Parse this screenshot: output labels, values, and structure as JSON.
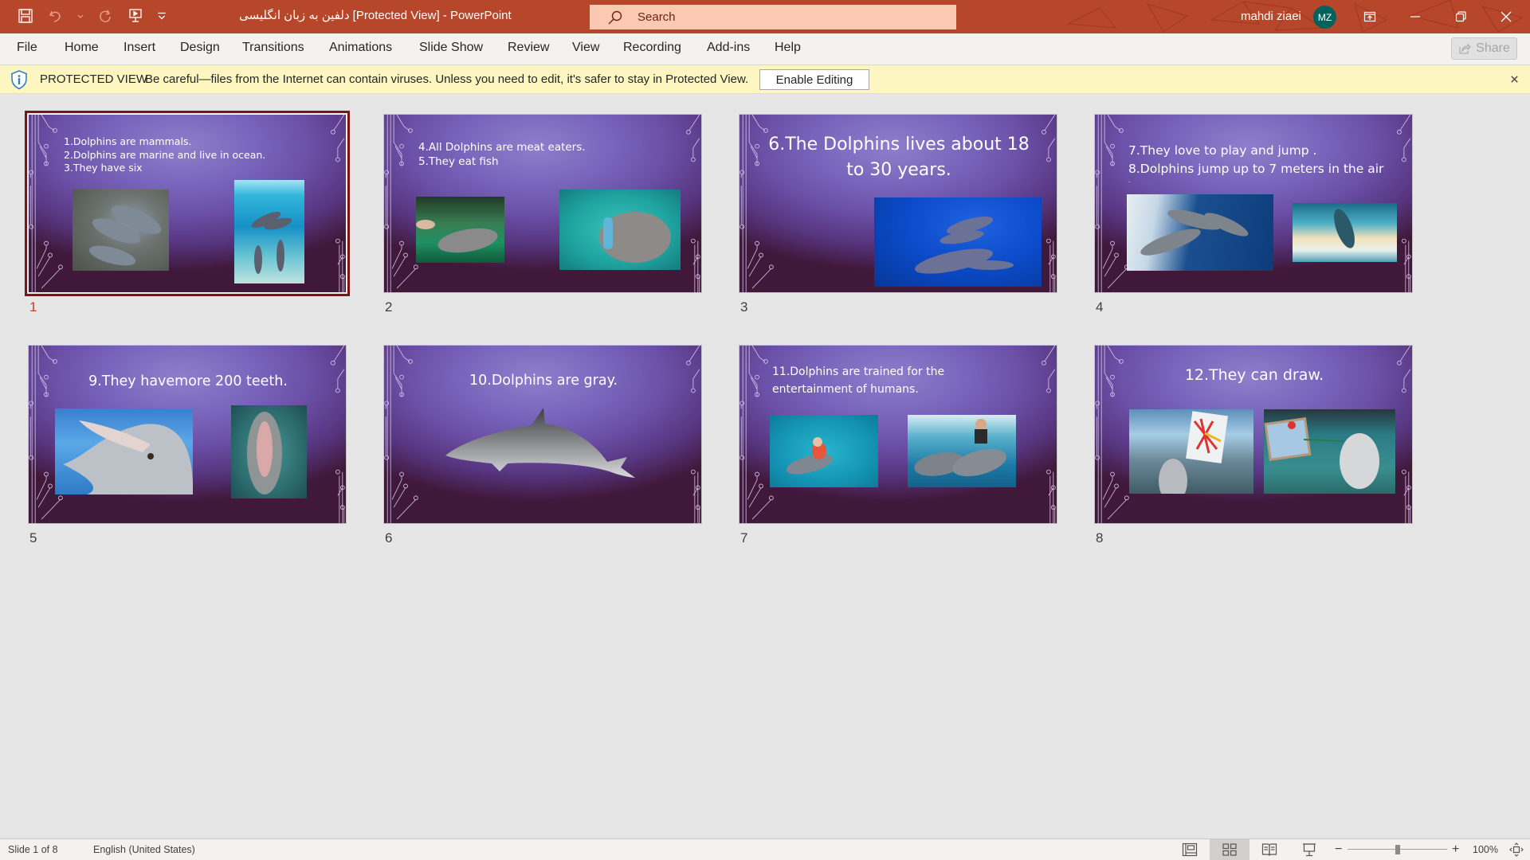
{
  "app": {
    "document_name": "دلفین به زبان انگلیسی",
    "title": "دلفین به زبان انگلیسی [Protected View]  -  PowerPoint",
    "search_placeholder": "Search",
    "user_name": "mahdi ziaei",
    "user_initials": "MZ",
    "colors": {
      "titlebar": "#b7472a",
      "search_bg": "#fbc8b2",
      "avatar": "#03625b",
      "protected_view_bg": "#fdf6c1",
      "selection": "#7b1517",
      "slide_number_selected": "#c43e1c"
    }
  },
  "quick_access": [
    {
      "icon": "save-icon"
    },
    {
      "icon": "undo-icon"
    },
    {
      "icon": "redo-icon"
    },
    {
      "icon": "start-slideshow-icon"
    },
    {
      "icon": "customize-qat-icon"
    }
  ],
  "ribbon": {
    "tabs": [
      "File",
      "Home",
      "Insert",
      "Design",
      "Transitions",
      "Animations",
      "Slide Show",
      "Review",
      "View",
      "Recording",
      "Add-ins",
      "Help"
    ],
    "share_label": "Share"
  },
  "protected_view": {
    "label": "PROTECTED VIEW",
    "message": "Be careful—files from the Internet can contain viruses. Unless you need to edit, it's safer to stay in Protected View.",
    "enable_button": "Enable Editing"
  },
  "slides": [
    {
      "number": "1",
      "selected": true,
      "lines": [
        "1.Dolphins are mammals.",
        "2.Dolphins are marine and live in ocean.",
        "3.They have six"
      ],
      "images": [
        "three dolphins swimming at surface",
        "dolphins underwater in blue water"
      ]
    },
    {
      "number": "2",
      "selected": false,
      "lines": [
        "4.All Dolphins are meat eaters.",
        "5.They eat fish"
      ],
      "images": [
        "hand feeding fish to dolphin",
        "dolphin holding colorful fish"
      ]
    },
    {
      "number": "3",
      "selected": false,
      "lines": [
        "6.The Dolphins lives about 18",
        "to 30 years."
      ],
      "images": [
        "pod of dolphins in deep blue ocean"
      ]
    },
    {
      "number": "4",
      "selected": false,
      "lines": [
        "7.They love to play and jump .",
        "8.Dolphins jump up to 7 meters in the air",
        "."
      ],
      "images": [
        "dolphins leaping out of waves",
        "dolphin jumping at sunset"
      ]
    },
    {
      "number": "5",
      "selected": false,
      "lines": [
        "9.They havemore 200 teeth."
      ],
      "images": [
        "smiling dolphin showing teeth",
        "dolphin with open mouth"
      ]
    },
    {
      "number": "6",
      "selected": false,
      "lines": [
        "10.Dolphins are gray."
      ],
      "images": [
        "gray dolphin cutout"
      ]
    },
    {
      "number": "7",
      "selected": false,
      "lines": [
        "11.Dolphins are trained for the",
        "entertainment of humans."
      ],
      "images": [
        "child riding dolphin in pool",
        "woman swimming with dolphins"
      ]
    },
    {
      "number": "8",
      "selected": false,
      "lines": [
        "12.They can draw."
      ],
      "images": [
        "dolphin painting on canvas",
        "beluga painting on canvas"
      ]
    }
  ],
  "status": {
    "slide_indicator": "Slide 1 of 8",
    "language": "English (United States)",
    "views": [
      "normal-view",
      "slide-sorter-view",
      "reading-view",
      "slideshow-view"
    ],
    "active_view": "slide-sorter-view",
    "zoom_percent": "100%",
    "zoom_level": 100
  }
}
